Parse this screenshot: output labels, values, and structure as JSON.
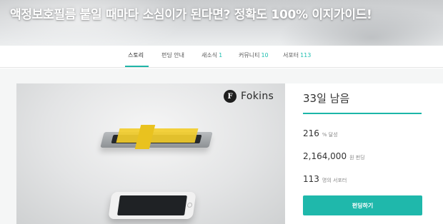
{
  "hero": {
    "title": "액정보호필름 붙일 때마다 소심이가 된다면? 정확도 100% 이지가이드!"
  },
  "tabs": [
    {
      "label": "스토리",
      "count": ""
    },
    {
      "label": "펀딩 안내",
      "count": ""
    },
    {
      "label": "새소식",
      "count": "1"
    },
    {
      "label": "커뮤니티",
      "count": "10"
    },
    {
      "label": "서포터",
      "count": "113"
    }
  ],
  "media": {
    "brand_mark": "F",
    "brand_name": "Fokins"
  },
  "panel": {
    "days_left": "33일 남음",
    "stats": [
      {
        "value": "216",
        "unit": "% 달성"
      },
      {
        "value": "2,164,000",
        "unit": "원 펀딩"
      },
      {
        "value": "113",
        "unit": "명의 서포터"
      }
    ],
    "cta_label": "펀딩하기"
  },
  "colors": {
    "accent": "#1fb8ab",
    "text": "#333333"
  }
}
